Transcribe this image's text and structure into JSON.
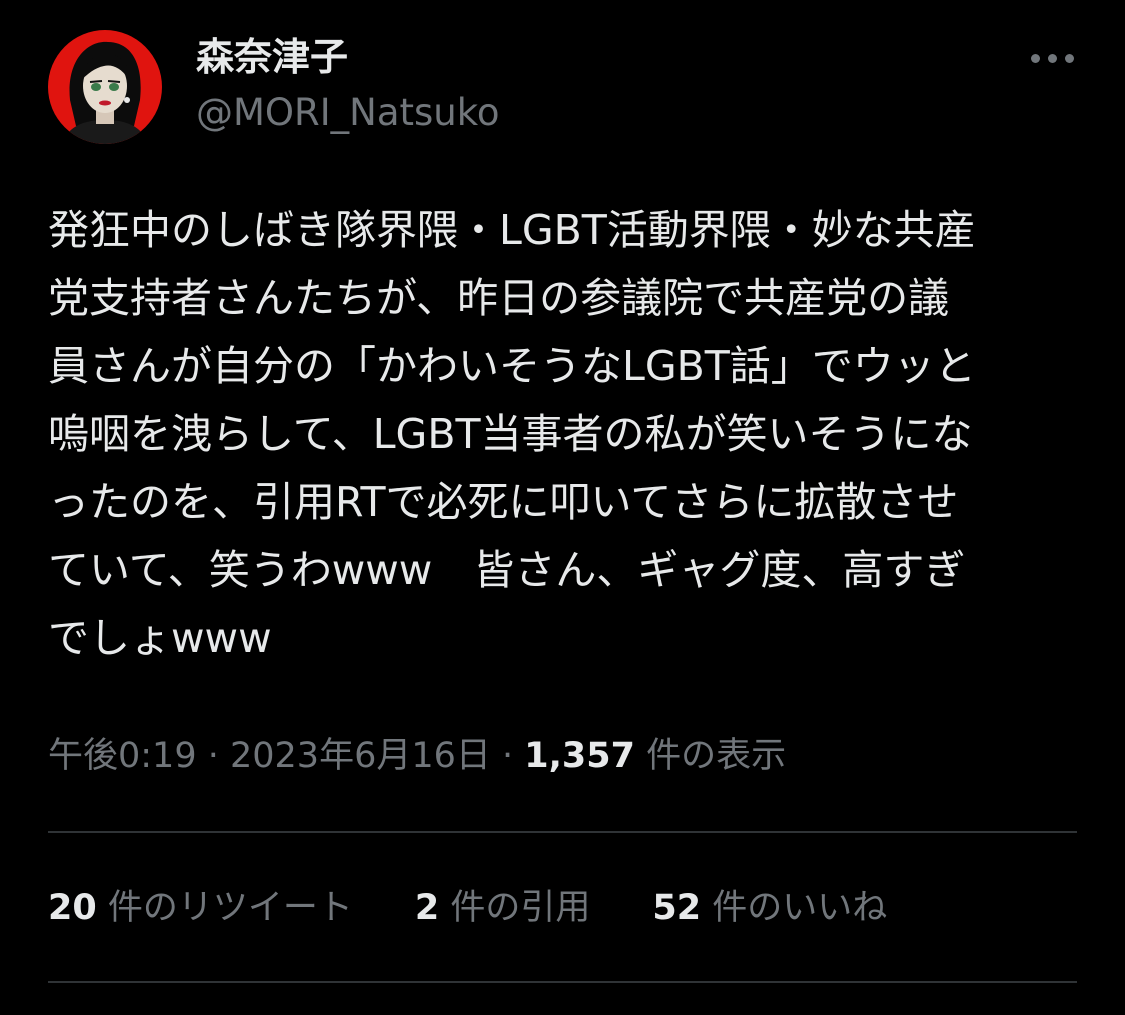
{
  "tweet": {
    "author": {
      "display_name": "森奈津子",
      "handle": "@MORI_Natsuko"
    },
    "more_icon": "more-horizontal-icon",
    "text_lines": [
      "発狂中のしばき隊界隈・LGBT活動界隈・妙な共産",
      "党支持者さんたちが、昨日の参議院で共産党の議",
      "員さんが自分の「かわいそうなLGBT話」でウッと",
      "嗚咽を洩らして、LGBT当事者の私が笑いそうにな",
      "ったのを、引用RTで必死に叩いてさらに拡散させ",
      "ていて、笑うわwww　皆さん、ギャグ度、高すぎ",
      "でしょwww"
    ],
    "meta": {
      "time": "午後0:19",
      "separator": " · ",
      "date": "2023年6月16日",
      "views_count": "1,357",
      "views_label": " 件の表示"
    },
    "stats": {
      "retweets_count": "20",
      "retweets_label": " 件のリツイート",
      "quotes_count": "2",
      "quotes_label": " 件の引用",
      "likes_count": "52",
      "likes_label": " 件のいいね"
    }
  },
  "colors": {
    "background": "#000000",
    "primary_text": "#e7e9ea",
    "secondary_text": "#71767b",
    "divider": "#2f3336",
    "avatar_background": "#e0140f"
  }
}
